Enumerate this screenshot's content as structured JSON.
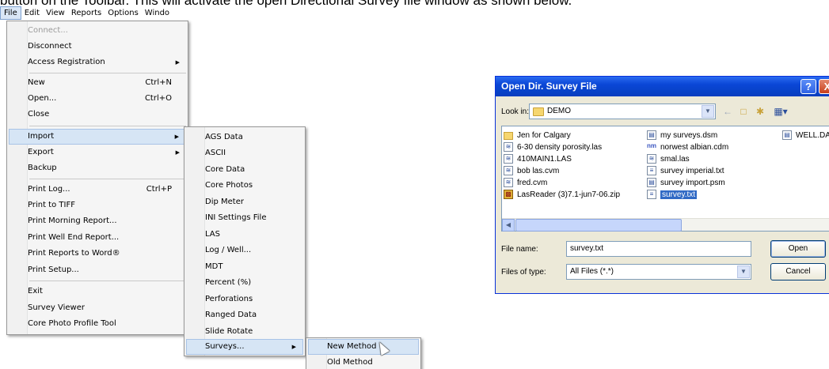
{
  "doc_text": "button on the Toolbar. This will activate the open Directional Survey file window as shown below.",
  "menubar": {
    "items": [
      "File",
      "Edit",
      "View",
      "Reports",
      "Options",
      "Windo"
    ]
  },
  "file_menu": {
    "items": [
      {
        "label": "Connect...",
        "shortcut": "",
        "disabled": true
      },
      {
        "label": "Disconnect",
        "shortcut": ""
      },
      {
        "label": "Access Registration",
        "shortcut": "",
        "submenu": true
      },
      {
        "label": "New",
        "shortcut": "Ctrl+N"
      },
      {
        "label": "Open...",
        "shortcut": "Ctrl+O"
      },
      {
        "label": "Close",
        "shortcut": ""
      },
      {
        "label": "Import",
        "shortcut": "",
        "submenu": true,
        "highlighted": true
      },
      {
        "label": "Export",
        "shortcut": "",
        "submenu": true
      },
      {
        "label": "Backup",
        "shortcut": ""
      },
      {
        "label": "Print Log...",
        "shortcut": "Ctrl+P"
      },
      {
        "label": "Print to TIFF",
        "shortcut": ""
      },
      {
        "label": "Print Morning Report...",
        "shortcut": ""
      },
      {
        "label": "Print Well End Report...",
        "shortcut": ""
      },
      {
        "label": "Print Reports to Word®",
        "shortcut": ""
      },
      {
        "label": "Print Setup...",
        "shortcut": ""
      },
      {
        "label": "Exit",
        "shortcut": ""
      },
      {
        "label": "Survey Viewer",
        "shortcut": ""
      },
      {
        "label": "Core Photo Profile Tool",
        "shortcut": ""
      }
    ]
  },
  "import_menu": {
    "items": [
      {
        "label": "AGS Data"
      },
      {
        "label": "ASCII"
      },
      {
        "label": "Core Data"
      },
      {
        "label": "Core Photos"
      },
      {
        "label": "Dip Meter"
      },
      {
        "label": "INI Settings File"
      },
      {
        "label": "LAS"
      },
      {
        "label": "Log / Well..."
      },
      {
        "label": "MDT"
      },
      {
        "label": "Percent (%)"
      },
      {
        "label": "Perforations"
      },
      {
        "label": "Ranged Data"
      },
      {
        "label": "Slide Rotate"
      },
      {
        "label": "Surveys...",
        "submenu": true,
        "highlighted": true
      }
    ]
  },
  "surveys_menu": {
    "items": [
      {
        "label": "New Method",
        "highlighted": true
      },
      {
        "label": "Old Method"
      }
    ]
  },
  "dialog": {
    "title": "Open Dir. Survey File",
    "help_label": "?",
    "close_label": "X",
    "look_in_label": "Look in:",
    "look_in_value": "DEMO",
    "files": [
      {
        "name": "Jen for Calgary",
        "icon": "folder-icon"
      },
      {
        "name": "6-30 density porosity.las",
        "icon": "las-file-icon"
      },
      {
        "name": "410MAIN1.LAS",
        "icon": "las-file-icon"
      },
      {
        "name": "bob las.cvm",
        "icon": "cvm-file-icon"
      },
      {
        "name": "fred.cvm",
        "icon": "cvm-file-icon"
      },
      {
        "name": "LasReader (3)7.1-jun7-06.zip",
        "icon": "zip-file-icon"
      },
      {
        "name": "my surveys.dsm",
        "icon": "dsm-file-icon"
      },
      {
        "name": "norwest albian.cdm",
        "icon": "cdm-file-icon"
      },
      {
        "name": "smal.las",
        "icon": "las-file-icon"
      },
      {
        "name": "survey imperial.txt",
        "icon": "txt-file-icon"
      },
      {
        "name": "survey import.psm",
        "icon": "psm-file-icon"
      },
      {
        "name": "survey.txt",
        "icon": "txt-file-icon",
        "selected": true
      },
      {
        "name": "WELL.DA",
        "icon": "dat-file-icon"
      }
    ],
    "file_name_label": "File name:",
    "file_name_value": "survey.txt",
    "files_of_type_label": "Files of type:",
    "files_of_type_value": "All Files (*.*)",
    "open_label": "Open",
    "cancel_label": "Cancel"
  }
}
